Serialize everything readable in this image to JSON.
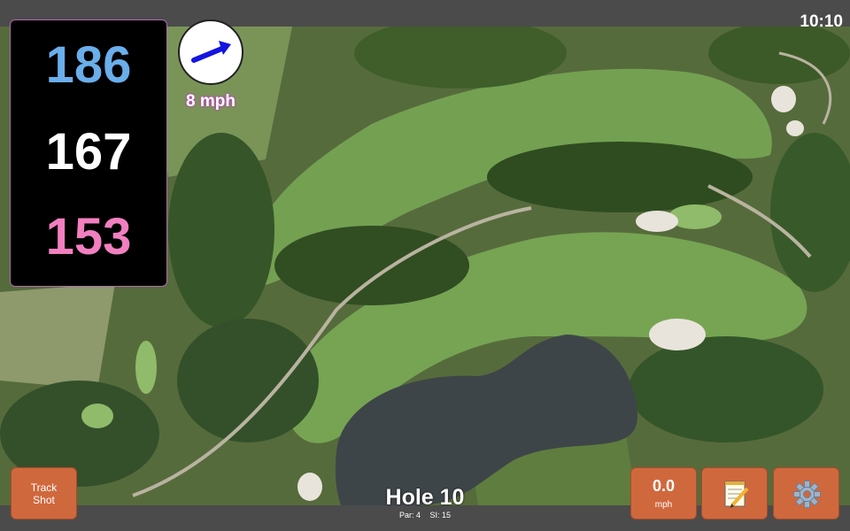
{
  "status_bar": {
    "time": "10:10"
  },
  "distances": {
    "back": "186",
    "middle": "167",
    "front": "153",
    "colors": {
      "back": "#6aaeea",
      "middle": "#ffffff",
      "front": "#f27fc0"
    }
  },
  "wind": {
    "speed": "8 mph",
    "icon": "wind-direction-arrow-icon",
    "arrow_color": "#1414e0"
  },
  "hole": {
    "title": "Hole 10",
    "par": "Par: 4",
    "si": "SI: 15"
  },
  "buttons": {
    "track_shot": "Track\nShot",
    "speed_value": "0.0",
    "speed_unit": "mph",
    "notes_icon": "notepad-pencil-icon",
    "settings_icon": "gear-icon"
  },
  "colors": {
    "button_bg": "#d0683e",
    "bar_bg": "#4b4b4b"
  }
}
